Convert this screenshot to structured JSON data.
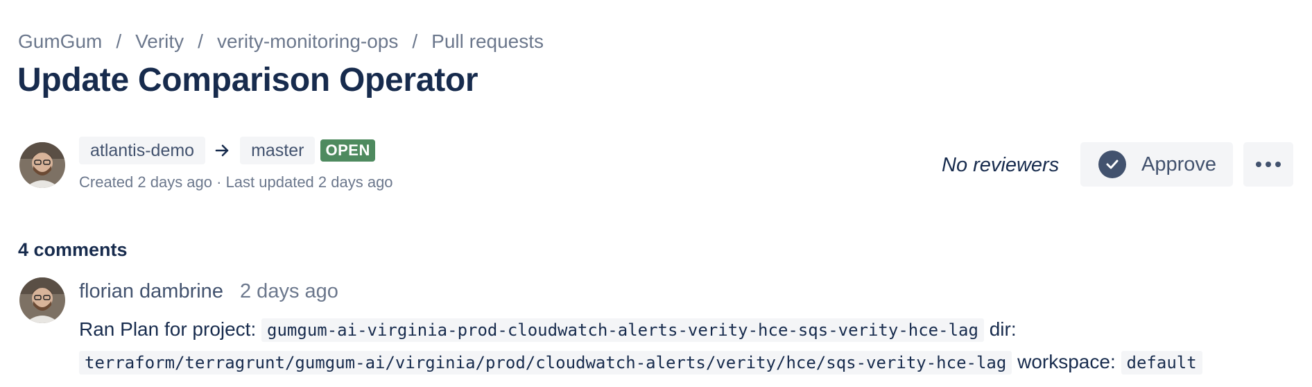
{
  "breadcrumb": {
    "items": [
      "GumGum",
      "Verity",
      "verity-monitoring-ops",
      "Pull requests"
    ],
    "separator": "/"
  },
  "pull_request": {
    "title": "Update Comparison Operator",
    "source_branch": "atlantis-demo",
    "target_branch": "master",
    "status": "OPEN",
    "meta": "Created 2 days ago · Last updated 2 days ago"
  },
  "review": {
    "no_reviewers": "No reviewers",
    "approve_label": "Approve"
  },
  "comments": {
    "heading": "4 comments",
    "items": [
      {
        "author": "florian dambrine",
        "time": "2 days ago",
        "text_1": "Ran Plan for project:",
        "project": "gumgum-ai-virginia-prod-cloudwatch-alerts-verity-hce-sqs-verity-hce-lag",
        "text_2": "dir:",
        "dir": "terraform/terragrunt/gumgum-ai/virginia/prod/cloudwatch-alerts/verity/hce/sqs-verity-hce-lag",
        "text_3": "workspace:",
        "workspace": "default"
      }
    ]
  },
  "icons": {
    "arrow": "arrow-right-icon",
    "check": "check-circle-icon",
    "more": "more-horizontal-icon",
    "avatar": "user-avatar"
  },
  "colors": {
    "status_open": "#4e8a5f",
    "title_text": "#172b4d",
    "muted_text": "#6b778c",
    "button_bg": "#f4f5f7",
    "check_bg": "#42526e"
  }
}
